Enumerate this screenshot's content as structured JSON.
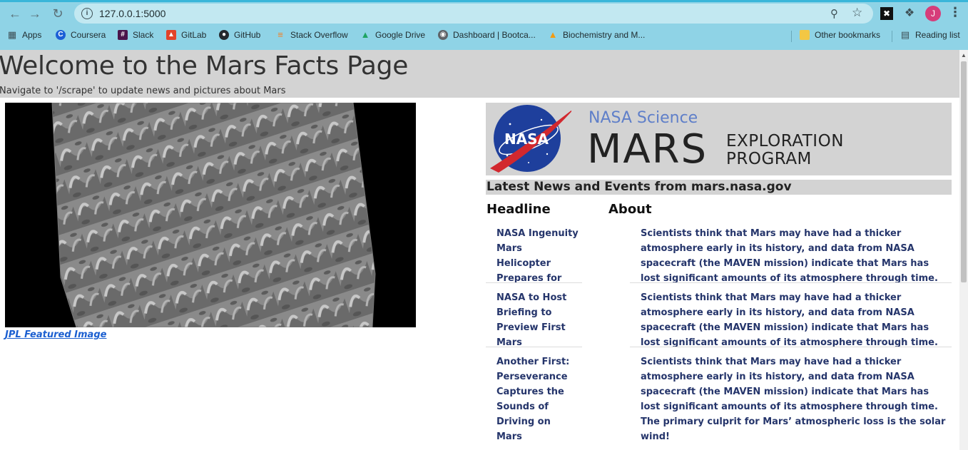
{
  "browser": {
    "url": "127.0.0.1:5000",
    "profile_initial": "J",
    "bookmarks": [
      {
        "label": "Apps",
        "icon": "apps-grid-icon"
      },
      {
        "label": "Coursera",
        "icon": "coursera-icon"
      },
      {
        "label": "Slack",
        "icon": "slack-icon"
      },
      {
        "label": "GitLab",
        "icon": "gitlab-icon"
      },
      {
        "label": "GitHub",
        "icon": "github-icon"
      },
      {
        "label": "Stack Overflow",
        "icon": "stackoverflow-icon"
      },
      {
        "label": "Google Drive",
        "icon": "google-drive-icon"
      },
      {
        "label": "Dashboard | Bootca...",
        "icon": "globe-icon"
      },
      {
        "label": "Biochemistry and M...",
        "icon": "flame-icon"
      }
    ],
    "other_bookmarks": "Other bookmarks",
    "reading_list": "Reading list"
  },
  "page": {
    "title": "Welcome to the Mars Facts Page",
    "subtitle": "Navigate to '/scrape' to update news and pictures about Mars",
    "featured_link": "JPL Featured Image",
    "banner": {
      "science": "NASA Science",
      "mars": "MARS",
      "program_line1": "EXPLORATION",
      "program_line2": "PROGRAM",
      "logo_text": "NASA"
    },
    "news_header": "Latest News and Events from mars.nasa.gov",
    "columns": {
      "headline": "Headline",
      "about": "About"
    },
    "news": [
      {
        "headline": "NASA Ingenuity Mars Helicopter Prepares for",
        "about": "Scientists think that Mars may have had a thicker atmosphere early in its history, and data from NASA spacecraft (the MAVEN mission) indicate that Mars has lost significant amounts of its atmosphere through time. The primary culprit"
      },
      {
        "headline": "NASA to Host Briefing to Preview First Mars",
        "about": "Scientists think that Mars may have had a thicker atmosphere early in its history, and data from NASA spacecraft (the MAVEN mission) indicate that Mars has lost significant amounts of its atmosphere through time. The primary culprit"
      },
      {
        "headline": "Another First: Perseverance Captures the Sounds of Driving on Mars",
        "about": "Scientists think that Mars may have had a thicker atmosphere early in its history, and data from NASA spacecraft (the MAVEN mission) indicate that Mars has lost significant amounts of its atmosphere through time. The primary culprit for Mars’ atmospheric loss is the solar wind!"
      }
    ]
  }
}
